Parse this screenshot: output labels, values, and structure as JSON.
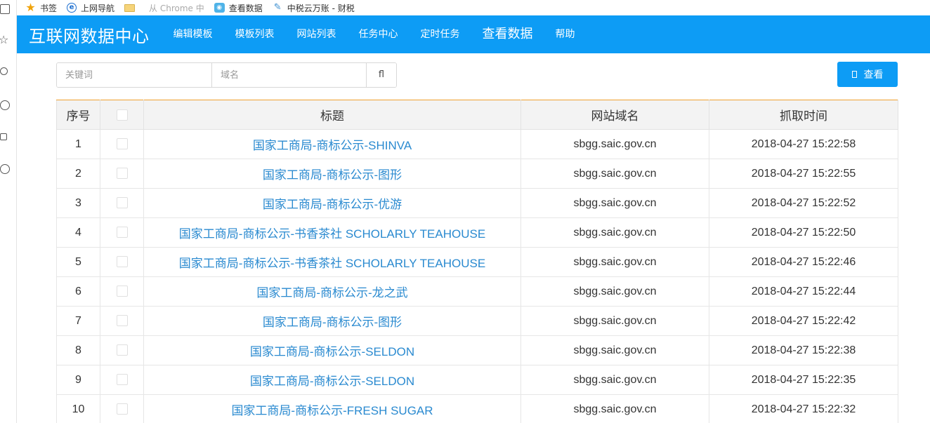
{
  "bookmarks": [
    {
      "icon": "star-icon",
      "label": "书签"
    },
    {
      "icon": "ie-icon",
      "label": "上网导航"
    },
    {
      "icon": "folder-icon",
      "label": "从 Chrome 中"
    },
    {
      "icon": "app-icon",
      "label": "查看数据"
    },
    {
      "icon": "leaf-icon",
      "label": "中税云万账 - 财税"
    }
  ],
  "header": {
    "brand": "互联网数据中心",
    "nav": [
      "编辑模板",
      "模板列表",
      "网站列表",
      "任务中心",
      "定时任务",
      "查看数据",
      "帮助"
    ],
    "accent_color": "#0d9cf5"
  },
  "search": {
    "keyword_placeholder": "关键词",
    "domain_placeholder": "域名",
    "filter_label": "fl",
    "view_button_label": "查看"
  },
  "table": {
    "columns": [
      "序号",
      "",
      "标题",
      "网站域名",
      "抓取时间"
    ],
    "rows": [
      {
        "index": "1",
        "title": "国家工商局-商标公示-SHINVA",
        "domain": "sbgg.saic.gov.cn",
        "time": "2018-04-27 15:22:58"
      },
      {
        "index": "2",
        "title": "国家工商局-商标公示-图形",
        "domain": "sbgg.saic.gov.cn",
        "time": "2018-04-27 15:22:55"
      },
      {
        "index": "3",
        "title": "国家工商局-商标公示-优游",
        "domain": "sbgg.saic.gov.cn",
        "time": "2018-04-27 15:22:52"
      },
      {
        "index": "4",
        "title": "国家工商局-商标公示-书香茶社 SCHOLARLY TEAHOUSE",
        "domain": "sbgg.saic.gov.cn",
        "time": "2018-04-27 15:22:50"
      },
      {
        "index": "5",
        "title": "国家工商局-商标公示-书香茶社 SCHOLARLY TEAHOUSE",
        "domain": "sbgg.saic.gov.cn",
        "time": "2018-04-27 15:22:46"
      },
      {
        "index": "6",
        "title": "国家工商局-商标公示-龙之武",
        "domain": "sbgg.saic.gov.cn",
        "time": "2018-04-27 15:22:44"
      },
      {
        "index": "7",
        "title": "国家工商局-商标公示-图形",
        "domain": "sbgg.saic.gov.cn",
        "time": "2018-04-27 15:22:42"
      },
      {
        "index": "8",
        "title": "国家工商局-商标公示-SELDON",
        "domain": "sbgg.saic.gov.cn",
        "time": "2018-04-27 15:22:38"
      },
      {
        "index": "9",
        "title": "国家工商局-商标公示-SELDON",
        "domain": "sbgg.saic.gov.cn",
        "time": "2018-04-27 15:22:35"
      },
      {
        "index": "10",
        "title": "国家工商局-商标公示-FRESH SUGAR",
        "domain": "sbgg.saic.gov.cn",
        "time": "2018-04-27 15:22:32"
      }
    ]
  }
}
